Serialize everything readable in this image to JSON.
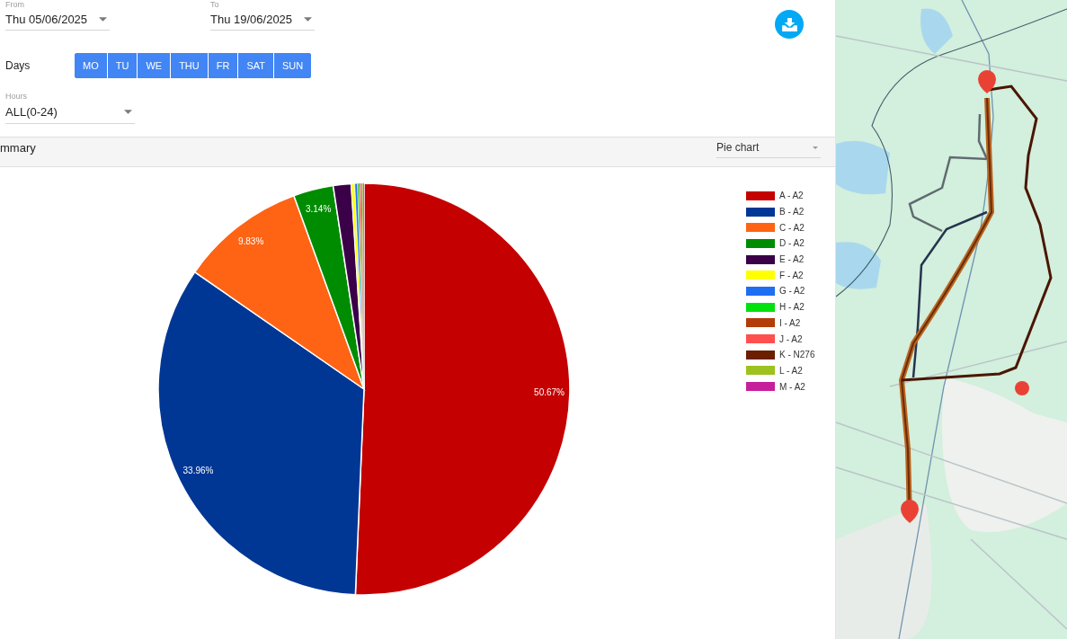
{
  "filters": {
    "from": {
      "label": "From",
      "value": "Thu 05/06/2025"
    },
    "to": {
      "label": "To",
      "value": "Thu 19/06/2025"
    },
    "days": {
      "label": "Days",
      "options": [
        {
          "label": "MO",
          "selected": true
        },
        {
          "label": "TU",
          "selected": true
        },
        {
          "label": "WE",
          "selected": true
        },
        {
          "label": "THU",
          "selected": true
        },
        {
          "label": "FR",
          "selected": true
        },
        {
          "label": "SAT",
          "selected": true
        },
        {
          "label": "SUN",
          "selected": true
        }
      ]
    },
    "hours": {
      "label": "Hours",
      "value": "ALL(0-24)"
    }
  },
  "summary": {
    "title": "mmary",
    "chart_type": "Pie chart"
  },
  "chart": {
    "chart_data": {
      "type": "pie",
      "categories": [
        "A - A2",
        "B - A2",
        "C - A2",
        "D - A2",
        "E - A2",
        "F - A2",
        "G - A2",
        "H - A2",
        "I - A2",
        "J - A2",
        "K - N276",
        "L - A2",
        "M - A2"
      ],
      "values": [
        50.67,
        33.96,
        9.83,
        3.14,
        1.4,
        0.28,
        0.21,
        0.1,
        0.09,
        0.08,
        0.08,
        0.08,
        0.08
      ],
      "colors": [
        "#c40000",
        "#003795",
        "#ff6314",
        "#008c00",
        "#3a0048",
        "#ffff00",
        "#1f6ef2",
        "#00e10e",
        "#b23c0a",
        "#ff4f4f",
        "#6b1e00",
        "#9dc21f",
        "#c61f9b"
      ],
      "legend": "right",
      "annotations": [
        {
          "x": "A - A2",
          "text": "50.67%"
        },
        {
          "x": "B - A2",
          "text": "33.96%"
        },
        {
          "x": "C - A2",
          "text": "9.83%"
        },
        {
          "x": "D - A2",
          "text": "3.14%"
        }
      ]
    }
  }
}
